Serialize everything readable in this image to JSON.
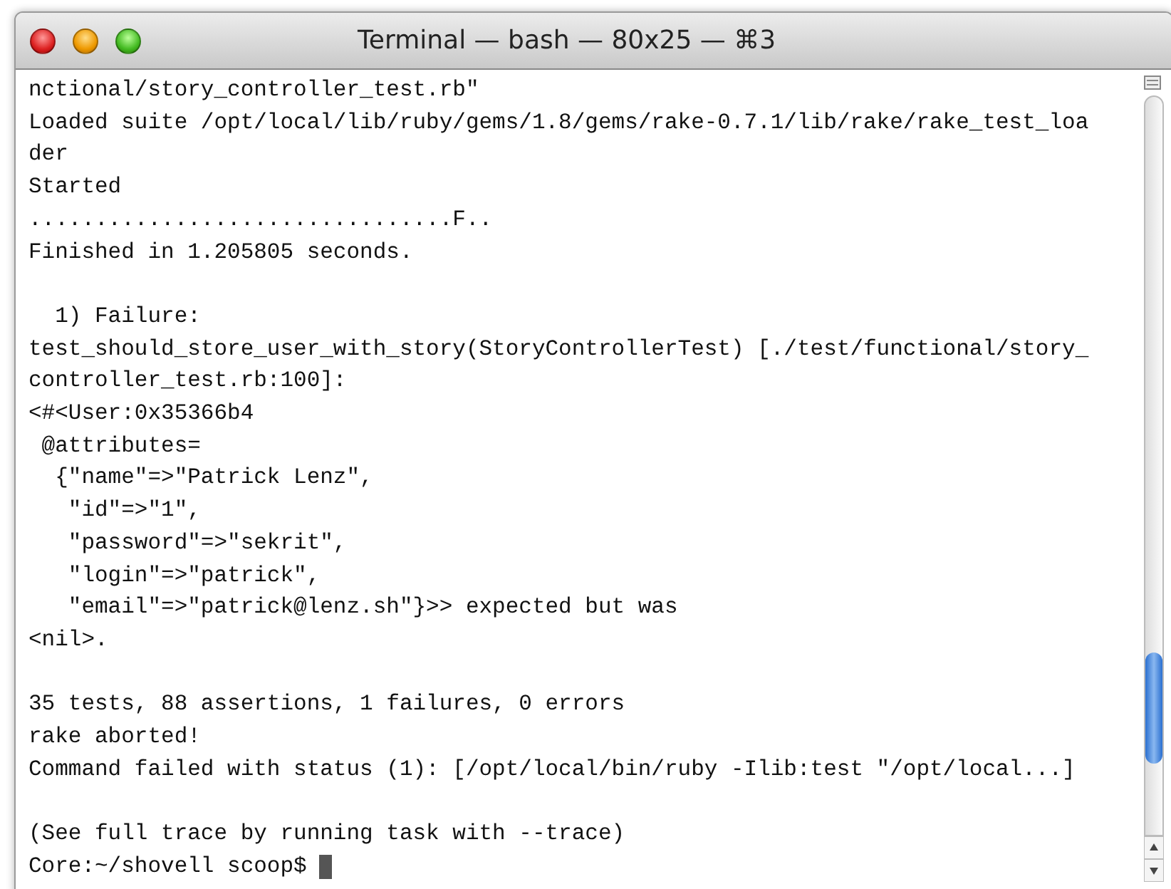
{
  "window": {
    "title": "Terminal — bash — 80x25 — ⌘3"
  },
  "terminal": {
    "lines": [
      {
        "kind": "text",
        "text": "nctional/story_controller_test.rb\""
      },
      {
        "kind": "text",
        "text": "Loaded suite /opt/local/lib/ruby/gems/1.8/gems/rake-0.7.1/lib/rake/rake_test_loa"
      },
      {
        "kind": "text",
        "text": "der"
      },
      {
        "kind": "text",
        "text": "Started"
      },
      {
        "kind": "text",
        "text": "................................F.."
      },
      {
        "kind": "text",
        "text": "Finished in 1.205805 seconds."
      },
      {
        "kind": "blank"
      },
      {
        "kind": "text",
        "text": "  1) Failure:"
      },
      {
        "kind": "text",
        "text": "test_should_store_user_with_story(StoryControllerTest) [./test/functional/story_"
      },
      {
        "kind": "text",
        "text": "controller_test.rb:100]:"
      },
      {
        "kind": "text",
        "text": "<#<User:0x35366b4"
      },
      {
        "kind": "text",
        "text": " @attributes="
      },
      {
        "kind": "text",
        "text": "  {\"name\"=>\"Patrick Lenz\","
      },
      {
        "kind": "text",
        "text": "   \"id\"=>\"1\","
      },
      {
        "kind": "text",
        "text": "   \"password\"=>\"sekrit\","
      },
      {
        "kind": "text",
        "text": "   \"login\"=>\"patrick\","
      },
      {
        "kind": "text",
        "text": "   \"email\"=>\"patrick@lenz.sh\"}>> expected but was"
      },
      {
        "kind": "text",
        "text": "<nil>."
      },
      {
        "kind": "blank"
      },
      {
        "kind": "text",
        "text": "35 tests, 88 assertions, 1 failures, 0 errors"
      },
      {
        "kind": "text",
        "text": "rake aborted!"
      },
      {
        "kind": "text",
        "text": "Command failed with status (1): [/opt/local/bin/ruby -Ilib:test \"/opt/local...]"
      },
      {
        "kind": "blank"
      },
      {
        "kind": "text",
        "text": "(See full trace by running task with --trace)"
      },
      {
        "kind": "prompt",
        "text": "Core:~/shovell scoop$"
      }
    ]
  }
}
